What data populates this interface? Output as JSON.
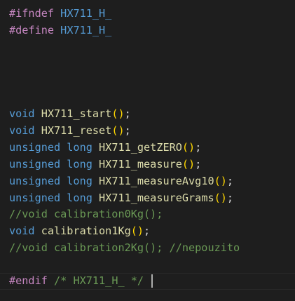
{
  "colors": {
    "background": "#1e1e1e",
    "directive": "#c586c0",
    "keyword": "#569cd6",
    "function": "#dcdcaa",
    "paren": "#ffd700",
    "comment": "#6a9955",
    "text": "#d4d4d4"
  },
  "code": {
    "ifndef": {
      "directive": "#ifndef",
      "macro": "HX711_H_"
    },
    "define": {
      "directive": "#define",
      "macro": "HX711_H_"
    },
    "start": {
      "type": "void",
      "name": "HX711_start",
      "parens": "()",
      "end": ";"
    },
    "reset": {
      "type": "void",
      "name": "HX711_reset",
      "parens": "()",
      "end": ";"
    },
    "get_zero": {
      "type": "unsigned long",
      "name": "HX711_getZERO",
      "parens": "()",
      "end": ";"
    },
    "measure": {
      "type": "unsigned long",
      "name": "HX711_measure",
      "parens": "()",
      "end": ";"
    },
    "measure_avg10": {
      "type": "unsigned long",
      "name": "HX711_measureAvg10",
      "parens": "()",
      "end": ";"
    },
    "measure_grams": {
      "type": "unsigned long",
      "name": "HX711_measureGrams",
      "parens": "()",
      "end": ";"
    },
    "comment_cal0": "//void calibration0Kg();",
    "cal1": {
      "type": "void",
      "name": "calibration1Kg",
      "parens": "()",
      "end": ";"
    },
    "comment_cal2": "//void calibration2Kg(); //nepouzito",
    "endif": {
      "directive": "#endif",
      "comment": "/* HX711_H_ */"
    }
  }
}
